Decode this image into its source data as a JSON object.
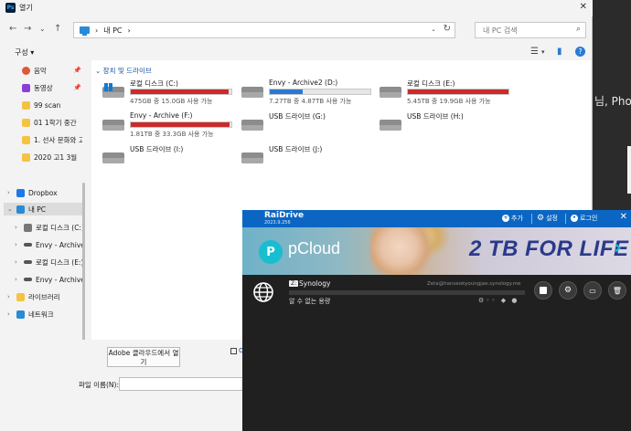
{
  "background": {
    "text": "님, Photo"
  },
  "dialog": {
    "title": "열기",
    "app_icon": "Ps",
    "close": "✕",
    "nav": {
      "back": "←",
      "forward": "→",
      "dropdown": "⌄",
      "up": "↑"
    },
    "address": {
      "location": "내 PC",
      "separator": "›",
      "trail": "›"
    },
    "search": {
      "placeholder": "내 PC 검색"
    },
    "toolbar": {
      "organize": "구성 ▾",
      "view_icon": "☰",
      "view_dd": "▾",
      "pane_icon": "▮",
      "help_icon": "?"
    },
    "navpane": {
      "items": [
        {
          "label": "음악",
          "icon": "music-icon",
          "color": "#e0583a",
          "pinned": true
        },
        {
          "label": "동영상",
          "icon": "video-icon",
          "color": "#8c3fd6",
          "pinned": true
        },
        {
          "label": "99 scan",
          "icon": "folder-icon",
          "color": "#f5c342"
        },
        {
          "label": "01 1학기 중간",
          "icon": "folder-icon",
          "color": "#f5c342"
        },
        {
          "label": "1. 선사 문화와 고",
          "icon": "folder-icon",
          "color": "#f5c342"
        },
        {
          "label": "2020 고1 3월",
          "icon": "folder-icon",
          "color": "#f5c342"
        },
        {
          "label": "Dropbox",
          "icon": "dropbox-icon",
          "color": "#1e78e6"
        },
        {
          "label": "내 PC",
          "icon": "pc-icon",
          "color": "#2a8ad4",
          "selected": true
        },
        {
          "label": "로컬 디스크 (C:)",
          "icon": "drive-icon",
          "color": "#777777"
        },
        {
          "label": "Envy - Archive",
          "icon": "drive-icon",
          "color": "#555555"
        },
        {
          "label": "로컬 디스크 (E:)",
          "icon": "drive-icon",
          "color": "#555555"
        },
        {
          "label": "Envy - Archive",
          "icon": "drive-icon",
          "color": "#555555"
        },
        {
          "label": "라이브러리",
          "icon": "folder-icon",
          "color": "#f5c342"
        },
        {
          "label": "네트워크",
          "icon": "network-icon",
          "color": "#2a8ad4"
        }
      ]
    },
    "section_title": "장치 및 드라이브",
    "drives": [
      {
        "name": "로컬 디스크 (C:)",
        "info": "475GB 중 15.0GB 사용 가능",
        "used": 0.97,
        "bar_color": "#cc2b2b",
        "system": true
      },
      {
        "name": "Envy - Archive2 (D:)",
        "info": "7.27TB 중 4.87TB 사용 가능",
        "used": 0.33,
        "bar_color": "#2a7ad4"
      },
      {
        "name": "로컬 디스크 (E:)",
        "info": "5.45TB 중 19.9GB 사용 가능",
        "used": 0.996,
        "bar_color": "#cc2b2b"
      },
      {
        "name": "Envy - Archive (F:)",
        "info": "1.81TB 중 33.3GB 사용 가능",
        "used": 0.98,
        "bar_color": "#cc2b2b"
      },
      {
        "name": "USB 드라이브 (G:)"
      },
      {
        "name": "USB 드라이브 (H:)"
      },
      {
        "name": "USB 드라이브 (I:)"
      },
      {
        "name": "USB 드라이브 (J:)"
      }
    ],
    "bottom": {
      "adobe_button": "Adobe 클라우드에서 열기",
      "checkbox_label": "O",
      "filename_label": "파일 이름(N):",
      "filename_value": ""
    }
  },
  "raidrive": {
    "title": "RaiDrive",
    "version": "2023.9.256",
    "menu": {
      "add": "추가",
      "settings": "설정",
      "login": "로그인"
    },
    "close": "✕",
    "banner": {
      "brand": "pCloud",
      "slogan": "2 TB FOR LIFE",
      "next": "›"
    },
    "drive": {
      "letter": "Z:",
      "name": "Synology",
      "host": "Zeta@hanseokyoungjae.synology.me",
      "status": "알 수 없는 용량",
      "status_icons": "⚙◦◦ ◆ ●"
    }
  }
}
